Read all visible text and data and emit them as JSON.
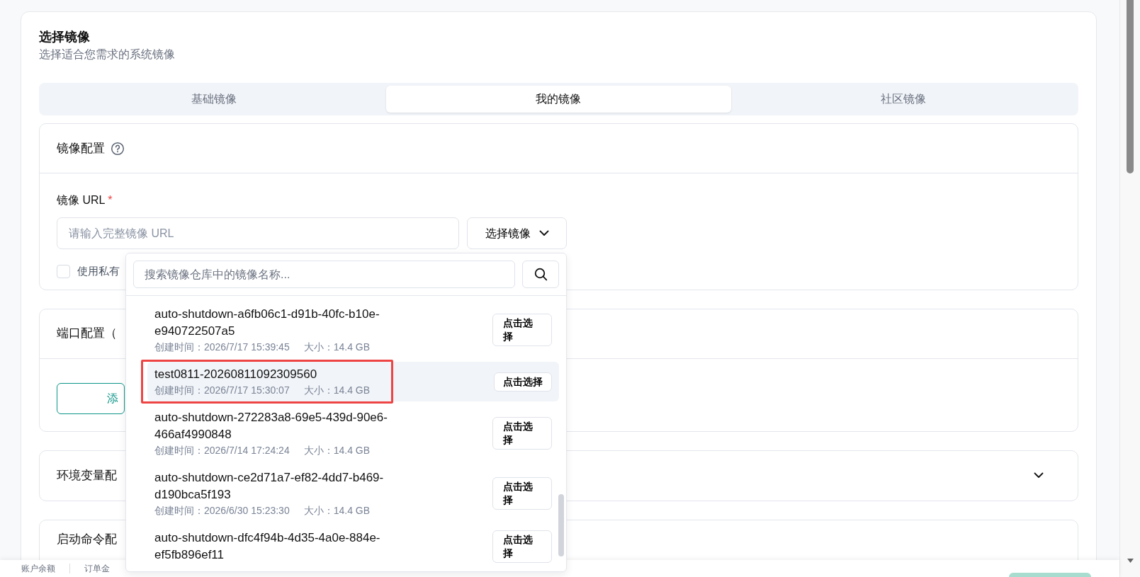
{
  "header": {
    "title": "选择镜像",
    "subtitle": "选择适合您需求的系统镜像"
  },
  "tabs": [
    {
      "label": "基础镜像",
      "selected": false
    },
    {
      "label": "我的镜像",
      "selected": true
    },
    {
      "label": "社区镜像",
      "selected": false
    }
  ],
  "image_config": {
    "title": "镜像配置",
    "url_label": "镜像 URL",
    "required_mark": "*",
    "url_placeholder": "请输入完整镜像 URL",
    "select_button": "选择镜像",
    "private_checkbox": {
      "label": "使用私有",
      "checked": false
    }
  },
  "port_config": {
    "title": "端口配置（",
    "add_button": "添"
  },
  "env_config": {
    "title": "环境变量配",
    "expanded": false
  },
  "startup_config": {
    "title": "启动命令配"
  },
  "dropdown": {
    "search_placeholder": "搜索镜像仓库中的镜像名称...",
    "items": [
      {
        "name": "auto-shutdown-a6fb06c1-d91b-40fc-b10e-e940722507a5",
        "created": "创建时间：2026/7/17 15:39:45",
        "size": "大小：14.4 GB",
        "button": "点击选择",
        "selected": false,
        "annotated": false
      },
      {
        "name": "test0811-20260811092309560",
        "created": "创建时间：2026/7/17 15:30:07",
        "size": "大小：14.4 GB",
        "button": "点击选择",
        "selected": true,
        "annotated": true
      },
      {
        "name": "auto-shutdown-272283a8-69e5-439d-90e6-466af4990848",
        "created": "创建时间：2026/7/14 17:24:24",
        "size": "大小：14.4 GB",
        "button": "点击选择",
        "selected": false,
        "annotated": false
      },
      {
        "name": "auto-shutdown-ce2d71a7-ef82-4dd7-b469-d190bca5f193",
        "created": "创建时间：2026/6/30 15:23:30",
        "size": "大小：14.4 GB",
        "button": "点击选择",
        "selected": false,
        "annotated": false
      },
      {
        "name": "auto-shutdown-dfc4f94b-4d35-4a0e-884e-ef5fb896ef11",
        "button": "点击选择",
        "selected": false,
        "annotated": false
      }
    ]
  },
  "footer": {
    "items": [
      "账户余额",
      "订单金"
    ]
  }
}
